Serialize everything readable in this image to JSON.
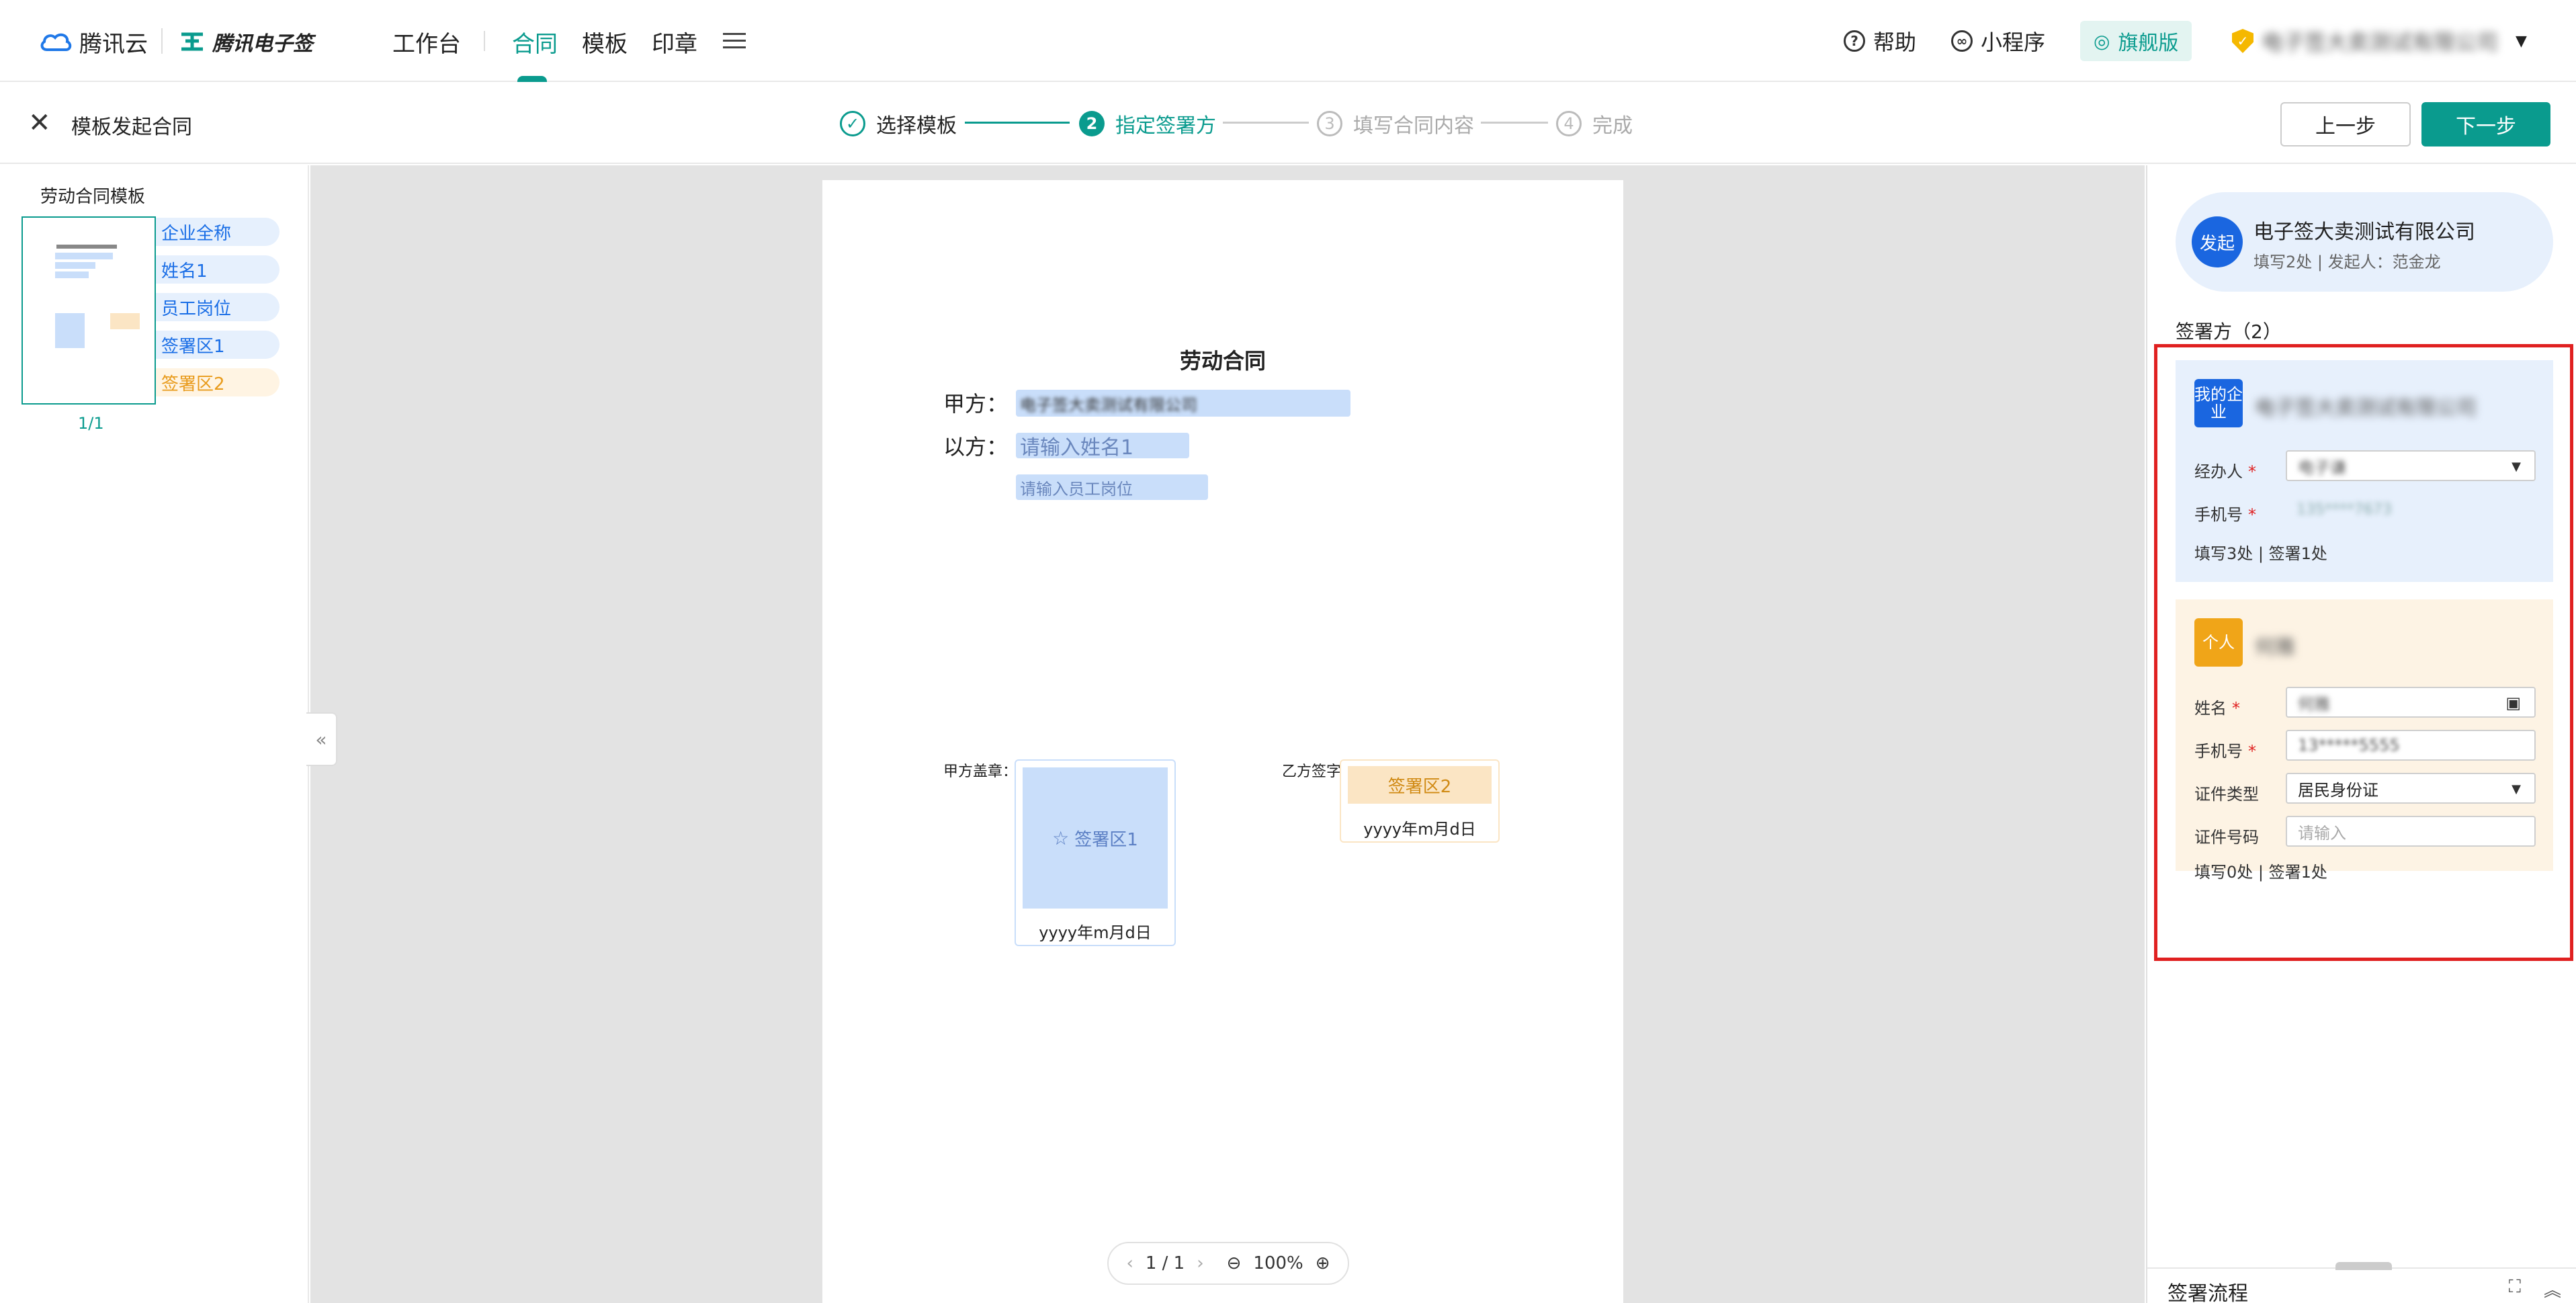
{
  "header": {
    "brand1": "腾讯云",
    "brand2": "腾讯电子签",
    "nav": [
      "工作台",
      "合同",
      "模板",
      "印章"
    ],
    "active_nav": "合同",
    "help": "帮助",
    "miniprogram": "小程序",
    "edition": "旗舰版",
    "company": "电子签大卖测试有限公司"
  },
  "stepbar": {
    "title": "模板发起合同",
    "steps": [
      {
        "num": "✓",
        "label": "选择模板",
        "state": "done"
      },
      {
        "num": "2",
        "label": "指定签署方",
        "state": "current"
      },
      {
        "num": "3",
        "label": "填写合同内容",
        "state": "todo"
      },
      {
        "num": "4",
        "label": "完成",
        "state": "todo"
      }
    ],
    "prev": "上一步",
    "next": "下一步"
  },
  "left": {
    "title": "劳动合同模板",
    "page": "1/1",
    "fields": [
      "企业全称",
      "姓名1",
      "员工岗位",
      "签署区1",
      "签署区2"
    ]
  },
  "doc": {
    "title": "劳动合同",
    "party_a_label": "甲方：",
    "party_a_value": "电子签大卖测试有限公司",
    "party_b_label": "以方：",
    "party_b_placeholder": "请输入姓名1",
    "position_placeholder": "请输入员工岗位",
    "seal_a_label": "甲方盖章：",
    "sign_b_label": "乙方签字",
    "sig1": "签署区1",
    "sig2": "签署区2",
    "date_placeholder": "yyyy年m月d日",
    "pager": "1 / 1",
    "zoom": "100%"
  },
  "right": {
    "initiator_badge": "发起",
    "initiator_name": "电子签大卖测试有限公司",
    "initiator_sub": "填写2处 | 发起人：范金龙",
    "signers_title": "签署方（2）",
    "company_card": {
      "badge": "我的企业",
      "name": "电子签大卖测试有限公司",
      "handler_label": "经办人",
      "handler_value": "电子谦",
      "phone_label": "手机号",
      "phone_value": "135****7673",
      "summary": "填写3处 | 签署1处"
    },
    "person_card": {
      "badge": "个人",
      "name": "何雅",
      "name_label": "姓名",
      "name_value": "何雅",
      "phone_label": "手机号",
      "phone_value": "13*****5555",
      "idtype_label": "证件类型",
      "idtype_value": "居民身份证",
      "idno_label": "证件号码",
      "idno_placeholder": "请输入",
      "summary": "填写0处 | 签署1处"
    },
    "flow_title": "签署流程"
  },
  "colors": {
    "brand": "#0a9b8e",
    "blue": "#1a66e0",
    "orange": "#f0a518",
    "highlight": "#e02020"
  }
}
